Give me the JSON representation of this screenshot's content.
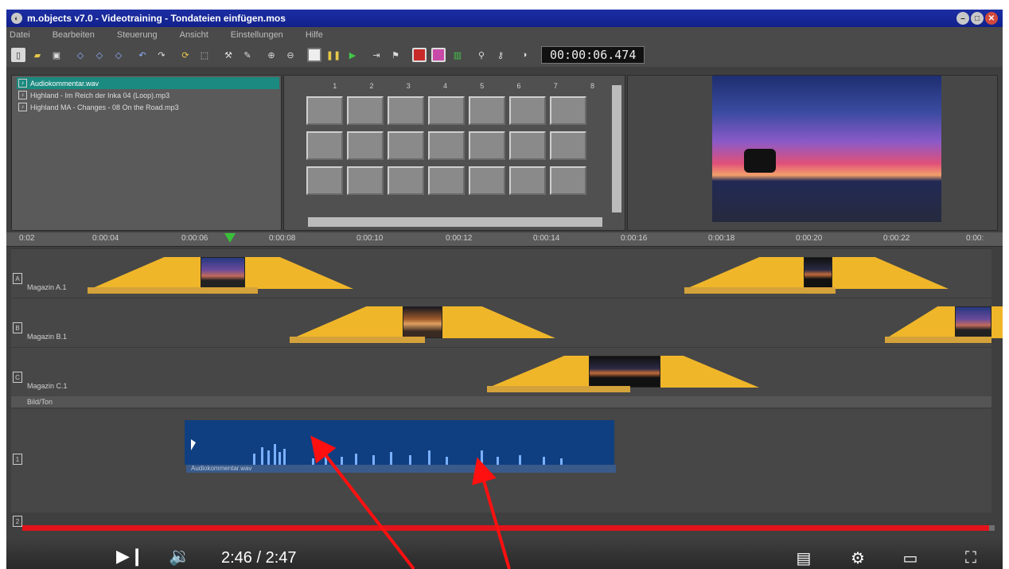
{
  "window": {
    "title": "m.objects v7.0 - Videotraining - Tondateien einfügen.mos",
    "app_icon": "app-logo-icon"
  },
  "menu": {
    "items": [
      "Datei",
      "Bearbeiten",
      "Steuerung",
      "Ansicht",
      "Einstellungen",
      "Hilfe"
    ]
  },
  "toolbar": {
    "timecode": "00:00:06.474"
  },
  "media_list": {
    "items": [
      "Audiokommentar.wav",
      "Highland - Im Reich der Inka 04 (Loop).mp3",
      "Highland MA - Changes - 08 On the Road.mp3"
    ]
  },
  "lightbox": {
    "columns": [
      "1",
      "2",
      "3",
      "4",
      "5",
      "6",
      "7",
      "8"
    ]
  },
  "ruler": {
    "labels": [
      "0:02",
      "0:00:04",
      "0:00:06",
      "0:00:08",
      "0:00:10",
      "0:00:12",
      "0:00:14",
      "0:00:16",
      "0:00:18",
      "0:00:20",
      "0:00:22",
      "0:00:"
    ]
  },
  "tracks": [
    {
      "id": "A",
      "name": "Magazin A.1"
    },
    {
      "id": "B",
      "name": "Magazin B.1"
    },
    {
      "id": "C",
      "name": "Magazin C.1"
    }
  ],
  "audio": {
    "section_label": "Bild/Ton",
    "track_id": "1",
    "track_id_2": "2",
    "clip_label": "Audiokommentar.wav"
  },
  "player": {
    "time": "2:46 / 2:47",
    "progress": 0.994
  }
}
